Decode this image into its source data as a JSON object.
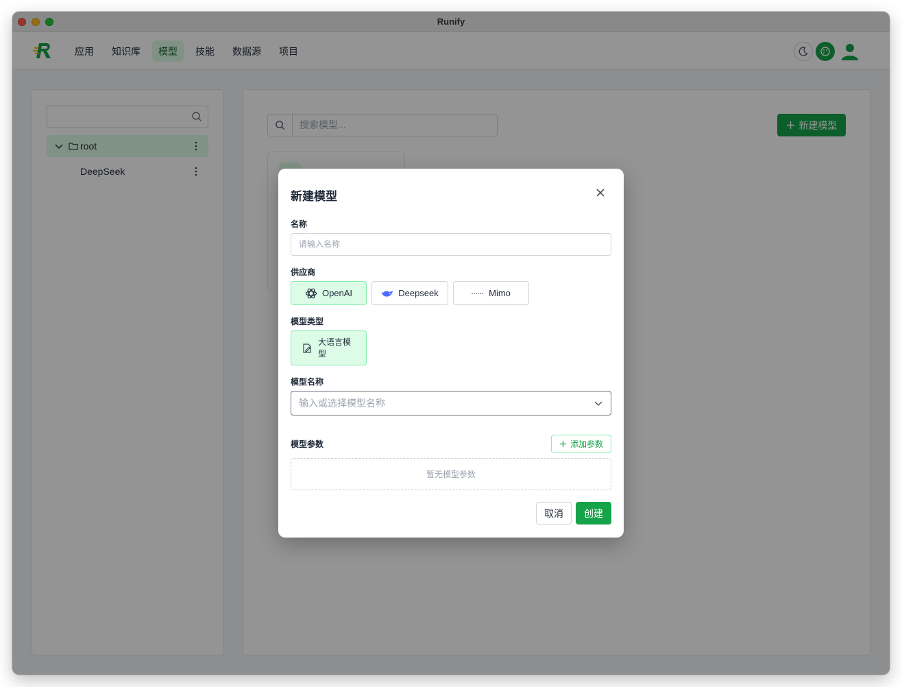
{
  "window": {
    "title": "Runify"
  },
  "nav": {
    "items": [
      {
        "label": "应用"
      },
      {
        "label": "知识库"
      },
      {
        "label": "模型",
        "active": true
      },
      {
        "label": "技能"
      },
      {
        "label": "数据源"
      },
      {
        "label": "项目"
      }
    ]
  },
  "icons": {
    "logo": "runify-logo",
    "theme": "moon-icon",
    "palette": "palette-icon",
    "user": "user-icon"
  },
  "sidebar": {
    "search_placeholder": "",
    "tree": {
      "root_label": "root",
      "children": [
        {
          "label": "DeepSeek"
        }
      ]
    }
  },
  "main": {
    "search_placeholder": "搜索模型...",
    "new_model_label": "新建模型"
  },
  "modal": {
    "title": "新建模型",
    "name": {
      "label": "名称",
      "placeholder": "请输入名称",
      "value": ""
    },
    "provider": {
      "label": "供应商",
      "options": [
        {
          "label": "OpenAI",
          "selected": true
        },
        {
          "label": "Deepseek",
          "selected": false
        },
        {
          "label": "Mimo",
          "selected": false
        }
      ]
    },
    "model_type": {
      "label": "模型类型",
      "options": [
        {
          "label": "大语言模型",
          "selected": true
        }
      ]
    },
    "model_name": {
      "label": "模型名称",
      "placeholder": "输入或选择模型名称"
    },
    "params": {
      "label": "模型参数",
      "add_label": "添加参数",
      "empty_text": "暂无模型参数"
    },
    "cancel_label": "取消",
    "create_label": "创建"
  },
  "colors": {
    "accent": "#16a34a",
    "accent_light": "#dcfce7",
    "overlay": "rgba(0,0,0,0.42)"
  }
}
